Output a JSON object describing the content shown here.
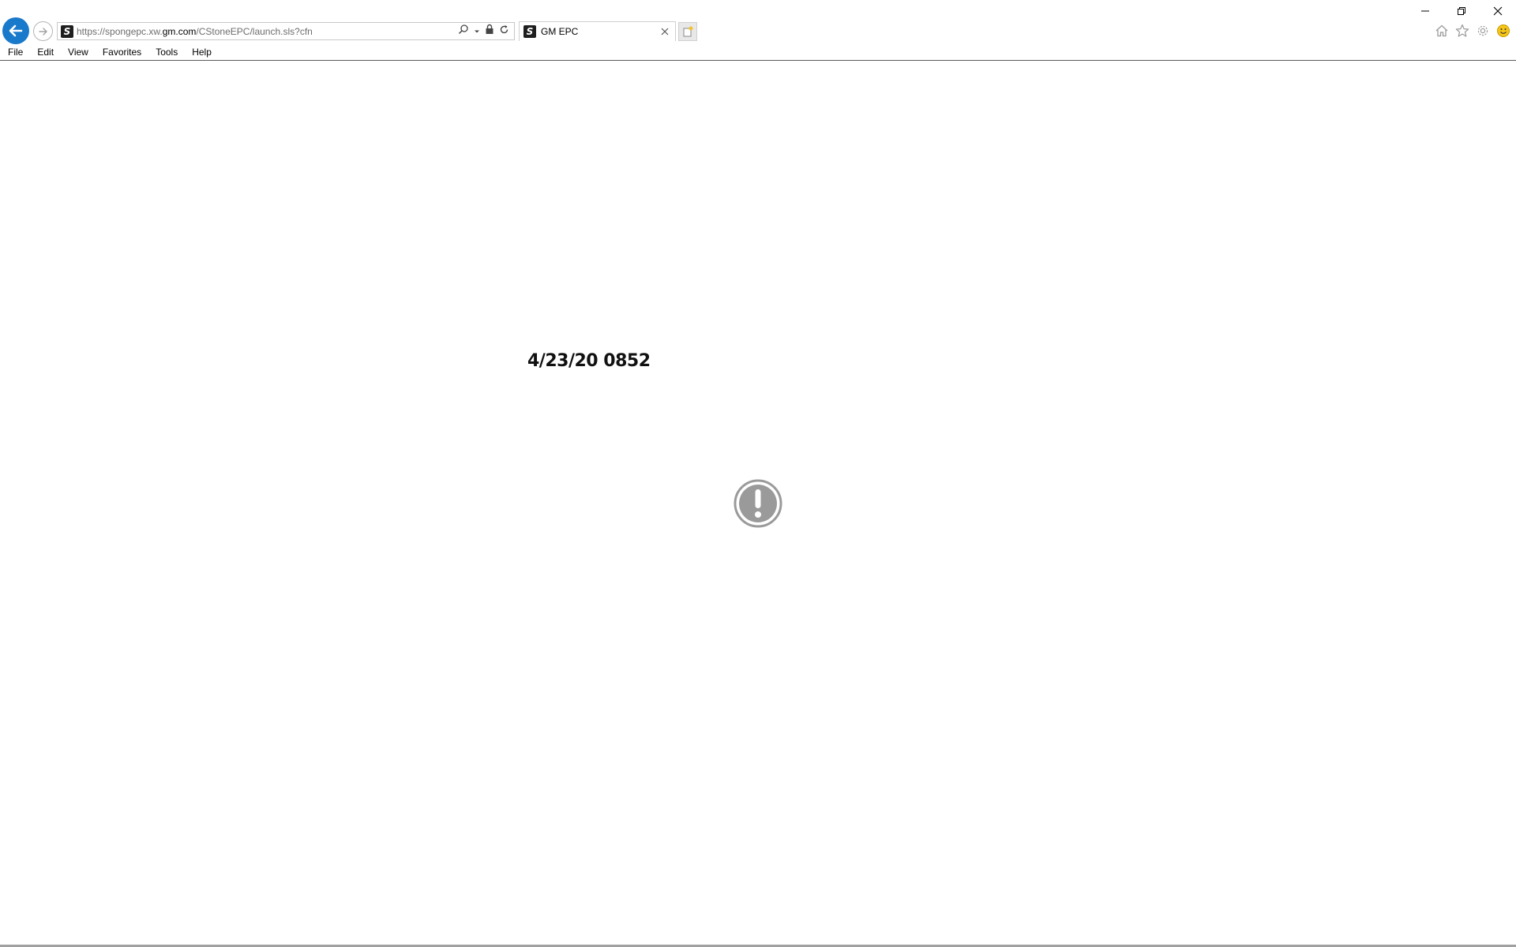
{
  "browser": {
    "address_bar": {
      "url_prefix": "https://spongepc.xw.",
      "url_host": "gm.com",
      "url_path": "/CStoneEPC/launch.sls?cfn"
    },
    "tab": {
      "title": "GM EPC",
      "favicon_glyph": "S"
    },
    "menu": [
      "File",
      "Edit",
      "View",
      "Favorites",
      "Tools",
      "Help"
    ],
    "icons": {
      "back": "back-arrow-icon",
      "forward": "forward-arrow-icon",
      "search": "search-icon",
      "lock": "lock-icon",
      "refresh": "refresh-icon",
      "home": "home-icon",
      "favorites": "star-icon",
      "settings": "gear-icon",
      "feedback": "smiley-icon"
    },
    "accent_color": "#1979ca"
  },
  "page": {
    "timestamp": "4/23/20 0852",
    "status_icon": "exclamation-circle-icon",
    "status_icon_color": "#9a9a9a"
  }
}
